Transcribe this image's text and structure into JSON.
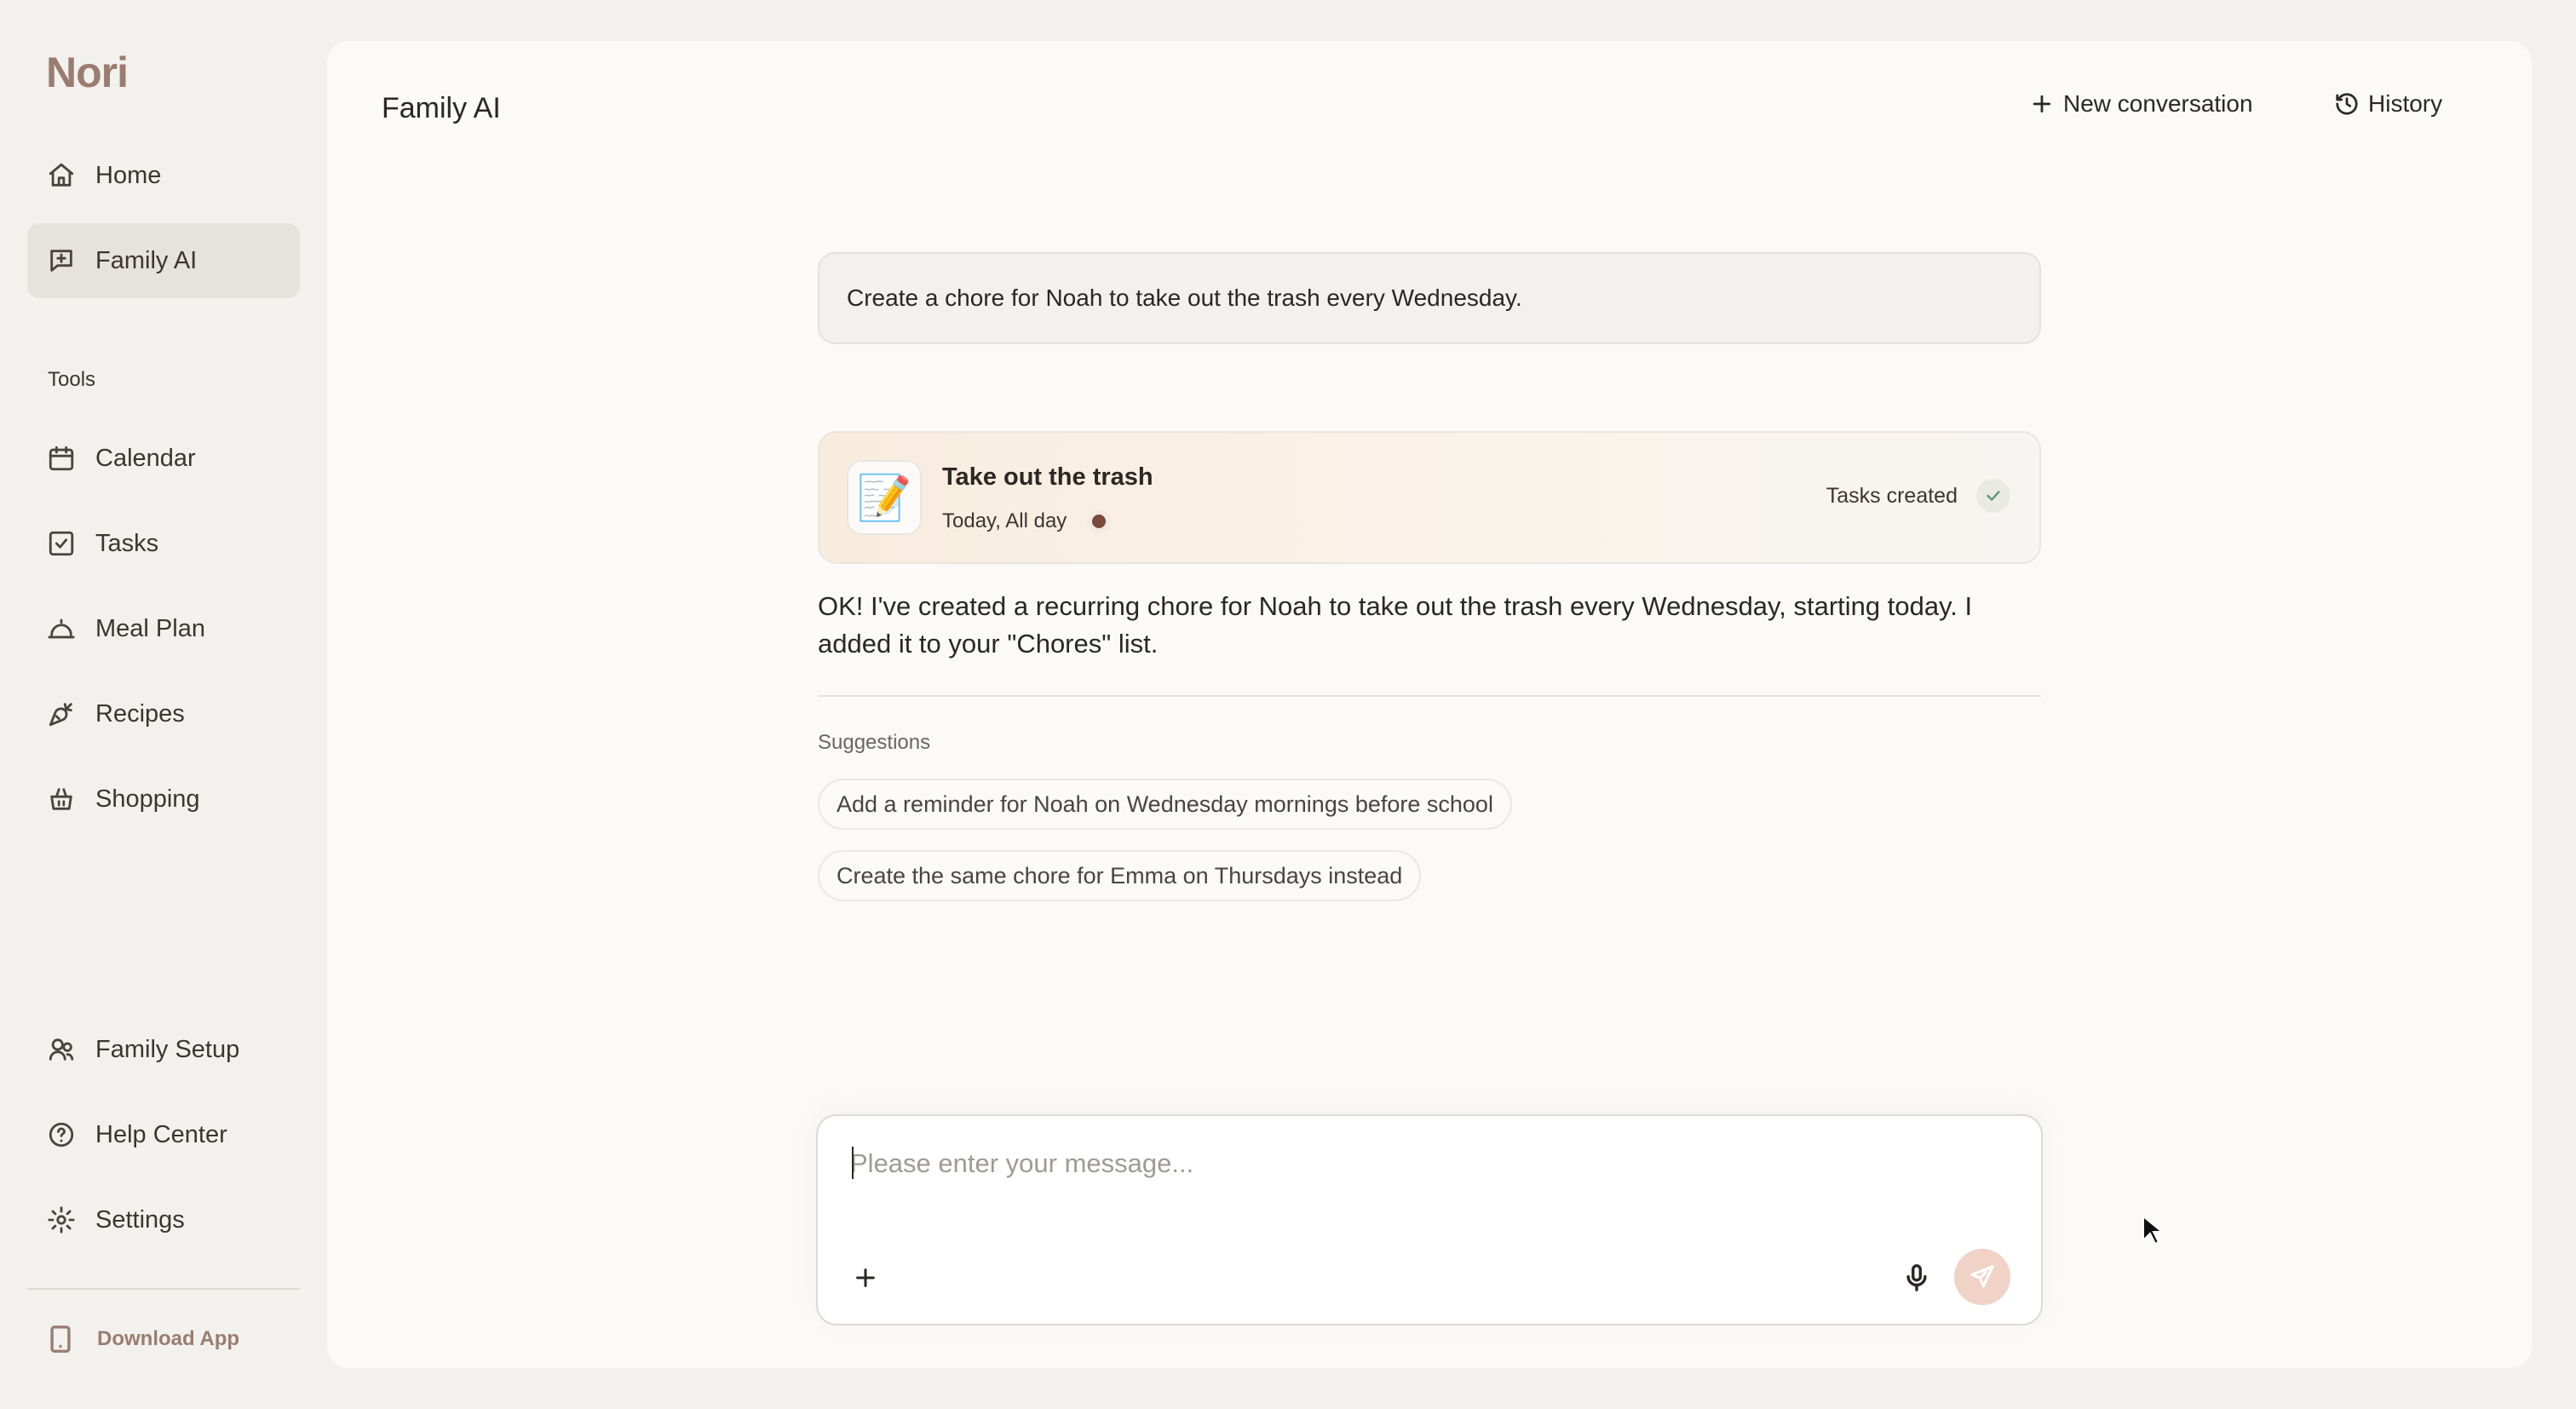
{
  "app": {
    "logo": "Nori"
  },
  "sidebar": {
    "nav": [
      {
        "label": "Home",
        "icon": "home-icon"
      },
      {
        "label": "Family AI",
        "icon": "chat-plus-icon",
        "active": true
      }
    ],
    "tools_label": "Tools",
    "tools": [
      {
        "label": "Calendar",
        "icon": "calendar-icon"
      },
      {
        "label": "Tasks",
        "icon": "checkbox-icon"
      },
      {
        "label": "Meal Plan",
        "icon": "cloche-icon"
      },
      {
        "label": "Recipes",
        "icon": "carrot-icon"
      },
      {
        "label": "Shopping",
        "icon": "basket-icon"
      }
    ],
    "bottom": [
      {
        "label": "Family Setup",
        "icon": "family-icon"
      },
      {
        "label": "Help Center",
        "icon": "help-icon"
      },
      {
        "label": "Settings",
        "icon": "gear-icon"
      }
    ],
    "download_label": "Download App"
  },
  "header": {
    "title": "Family AI",
    "new_conversation": "New conversation",
    "history": "History"
  },
  "conversation": {
    "user_message": "Create a chore for Noah to take out the trash every Wednesday.",
    "task_card": {
      "emoji": "📝",
      "title": "Take out the trash",
      "subtitle": "Today, All day",
      "status": "Tasks created"
    },
    "reply": "OK! I've created a recurring chore for Noah to take out the trash every Wednesday, starting today. I added it to your \"Chores\" list.",
    "suggestions_label": "Suggestions",
    "suggestions": [
      "Add a reminder for Noah on Wednesday mornings before school",
      "Create the same chore for Emma on Thursdays instead"
    ]
  },
  "composer": {
    "placeholder": "Please enter your message...",
    "value": ""
  },
  "colors": {
    "brand": "#9a7d70",
    "send_button": "#f0d2c6",
    "check": "#5b9a70"
  }
}
